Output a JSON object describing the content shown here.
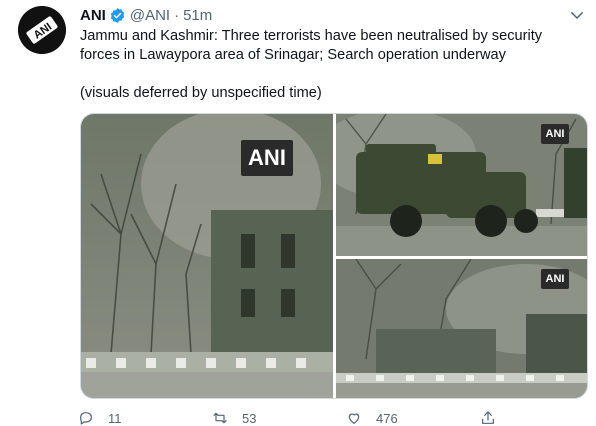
{
  "tweet": {
    "author_name": "ANI",
    "author_handle": "@ANI",
    "separator": "·",
    "time": "51m",
    "text_line1": "Jammu and Kashmir: Three terrorists have been neutralised by security forces in Lawaypora area of Srinagar; Search operation underway",
    "text_line2": "(visuals deferred by unspecified time)",
    "watermark": "ANI",
    "counts": {
      "replies": "11",
      "retweets": "53",
      "likes": "476"
    }
  },
  "colors": {
    "verified": "#1d9bf0",
    "muted": "#536471"
  },
  "icons": [
    "verified-badge-icon",
    "chevron-down-icon",
    "reply-icon",
    "retweet-icon",
    "like-icon",
    "share-icon"
  ]
}
